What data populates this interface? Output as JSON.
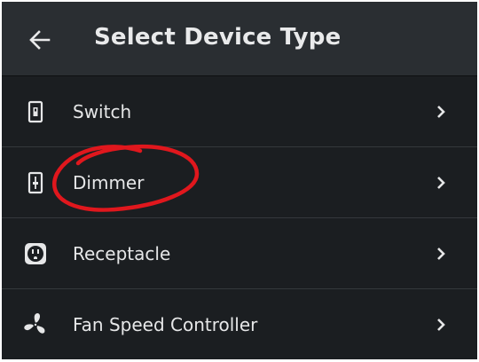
{
  "header": {
    "back_icon": "arrow-left-icon",
    "title": "Select Device Type"
  },
  "devices": [
    {
      "label": "Switch",
      "icon": "switch-icon"
    },
    {
      "label": "Dimmer",
      "icon": "dimmer-icon"
    },
    {
      "label": "Receptacle",
      "icon": "receptacle-icon"
    },
    {
      "label": "Fan Speed Controller",
      "icon": "fan-icon"
    }
  ],
  "colors": {
    "background": "#1b1e21",
    "header": "#2a2e32",
    "text": "#e6e7e8",
    "annotation": "#e0171d"
  }
}
